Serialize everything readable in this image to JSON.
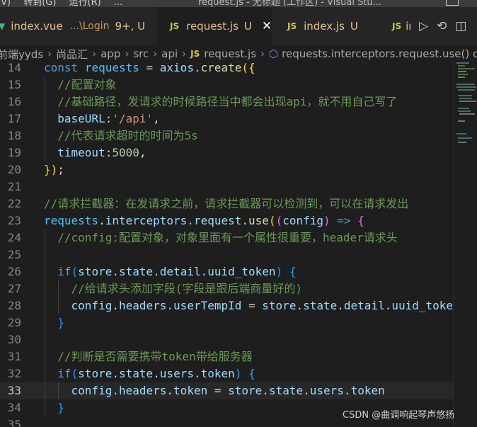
{
  "window": {
    "menu": [
      "(V)",
      "转到(G)",
      "运行(R)",
      "..."
    ],
    "title": "request.js - 无标题 (工作区) - Visual Stu..."
  },
  "tabs": [
    {
      "icon": "vue-icon",
      "name": "index.vue",
      "path": "...\\Login",
      "status": "9+, U",
      "active": false
    },
    {
      "icon": "js-icon",
      "name": "request.js",
      "status": "U",
      "active": true,
      "close": "✕"
    },
    {
      "icon": "js-icon",
      "name": "index.js",
      "status": "U",
      "active": false
    },
    {
      "icon": "js-icon",
      "name": "ir",
      "active": false
    }
  ],
  "breadcrumb": [
    "前端yyds",
    "尚品汇",
    "app",
    "src",
    "api",
    "request.js",
    "requests.interceptors.request.use() ca"
  ],
  "lines": [
    {
      "n": "14",
      "tokens": [
        [
          "k",
          "const"
        ],
        [
          "d",
          " "
        ],
        [
          "v",
          "requests"
        ],
        [
          "d",
          " = "
        ],
        [
          "p",
          "axios"
        ],
        [
          "d",
          "."
        ],
        [
          "f",
          "create"
        ],
        [
          "y",
          "({"
        ]
      ]
    },
    {
      "n": "15",
      "tokens": [
        [
          "d",
          "  "
        ],
        [
          "c",
          "//配置对象"
        ]
      ]
    },
    {
      "n": "16",
      "tokens": [
        [
          "d",
          "  "
        ],
        [
          "c",
          "//基础路径，发请求的时候路径当中都会出现api，就不用自己写了"
        ]
      ]
    },
    {
      "n": "17",
      "tokens": [
        [
          "d",
          "  "
        ],
        [
          "p",
          "baseURL"
        ],
        [
          "d",
          ":"
        ],
        [
          "s",
          "'/api'"
        ],
        [
          "d",
          ","
        ]
      ]
    },
    {
      "n": "18",
      "tokens": [
        [
          "d",
          "  "
        ],
        [
          "c",
          "//代表请求超时的时间为5s"
        ]
      ]
    },
    {
      "n": "19",
      "tokens": [
        [
          "d",
          "  "
        ],
        [
          "p",
          "timeout"
        ],
        [
          "d",
          ":"
        ],
        [
          "n",
          "5000"
        ],
        [
          "d",
          ","
        ]
      ]
    },
    {
      "n": "20",
      "tokens": [
        [
          "y",
          "})"
        ],
        [
          "d",
          ";"
        ]
      ]
    },
    {
      "n": "21",
      "tokens": []
    },
    {
      "n": "22",
      "tokens": [
        [
          "c",
          "//请求拦截器：在发请求之前，请求拦截器可以检测到，可以在请求发出"
        ]
      ]
    },
    {
      "n": "23",
      "tokens": [
        [
          "v",
          "requests"
        ],
        [
          "d",
          "."
        ],
        [
          "p",
          "interceptors"
        ],
        [
          "d",
          "."
        ],
        [
          "p",
          "request"
        ],
        [
          "d",
          "."
        ],
        [
          "f",
          "use"
        ],
        [
          "y",
          "("
        ],
        [
          "m",
          "("
        ],
        [
          "p",
          "config"
        ],
        [
          "m",
          ")"
        ],
        [
          "d",
          " "
        ],
        [
          "k",
          "=>"
        ],
        [
          "d",
          " "
        ],
        [
          "m",
          "{"
        ]
      ]
    },
    {
      "n": "24",
      "tokens": [
        [
          "d",
          "  "
        ],
        [
          "c",
          "//config:配置对象，对象里面有一个属性很重要，header请求头"
        ]
      ]
    },
    {
      "n": "25",
      "tokens": []
    },
    {
      "n": "26",
      "tokens": [
        [
          "d",
          "  "
        ],
        [
          "k",
          "if"
        ],
        [
          "b",
          "("
        ],
        [
          "p",
          "store"
        ],
        [
          "d",
          "."
        ],
        [
          "p",
          "state"
        ],
        [
          "d",
          "."
        ],
        [
          "p",
          "detail"
        ],
        [
          "d",
          "."
        ],
        [
          "p",
          "uuid_token"
        ],
        [
          "b",
          ")"
        ],
        [
          "d",
          " "
        ],
        [
          "b",
          "{"
        ]
      ]
    },
    {
      "n": "27",
      "tokens": [
        [
          "d",
          "    "
        ],
        [
          "c",
          "//给请求头添加字段(字段是跟后端商量好的)"
        ]
      ]
    },
    {
      "n": "28",
      "tokens": [
        [
          "d",
          "    "
        ],
        [
          "p",
          "config"
        ],
        [
          "d",
          "."
        ],
        [
          "p",
          "headers"
        ],
        [
          "d",
          "."
        ],
        [
          "p",
          "userTempId"
        ],
        [
          "d",
          " = "
        ],
        [
          "p",
          "store"
        ],
        [
          "d",
          "."
        ],
        [
          "p",
          "state"
        ],
        [
          "d",
          "."
        ],
        [
          "p",
          "detail"
        ],
        [
          "d",
          "."
        ],
        [
          "p",
          "uuid_toke"
        ]
      ]
    },
    {
      "n": "29",
      "tokens": [
        [
          "d",
          "  "
        ],
        [
          "b",
          "}"
        ]
      ]
    },
    {
      "n": "30",
      "tokens": []
    },
    {
      "n": "31",
      "tokens": [
        [
          "d",
          "  "
        ],
        [
          "c",
          "//判断是否需要携带token带给服务器"
        ]
      ]
    },
    {
      "n": "32",
      "tokens": [
        [
          "d",
          "  "
        ],
        [
          "k",
          "if"
        ],
        [
          "b",
          "("
        ],
        [
          "p",
          "store"
        ],
        [
          "d",
          "."
        ],
        [
          "p",
          "state"
        ],
        [
          "d",
          "."
        ],
        [
          "p",
          "users"
        ],
        [
          "d",
          "."
        ],
        [
          "p",
          "token"
        ],
        [
          "b",
          ")"
        ],
        [
          "d",
          " "
        ],
        [
          "b",
          "{"
        ]
      ]
    },
    {
      "n": "33",
      "current": true,
      "tokens": [
        [
          "d",
          "    "
        ],
        [
          "p",
          "config"
        ],
        [
          "d",
          "."
        ],
        [
          "p",
          "headers"
        ],
        [
          "d",
          "."
        ],
        [
          "p",
          "token"
        ],
        [
          "d",
          " = "
        ],
        [
          "p",
          "store"
        ],
        [
          "d",
          "."
        ],
        [
          "p",
          "state"
        ],
        [
          "d",
          "."
        ],
        [
          "p",
          "users"
        ],
        [
          "d",
          "."
        ],
        [
          "p",
          "token"
        ]
      ]
    },
    {
      "n": "34",
      "tokens": [
        [
          "d",
          "  "
        ],
        [
          "b",
          "}"
        ]
      ]
    },
    {
      "n": "35",
      "tokens": []
    }
  ],
  "watermark": "CSDN @曲调响起琴声悠扬"
}
